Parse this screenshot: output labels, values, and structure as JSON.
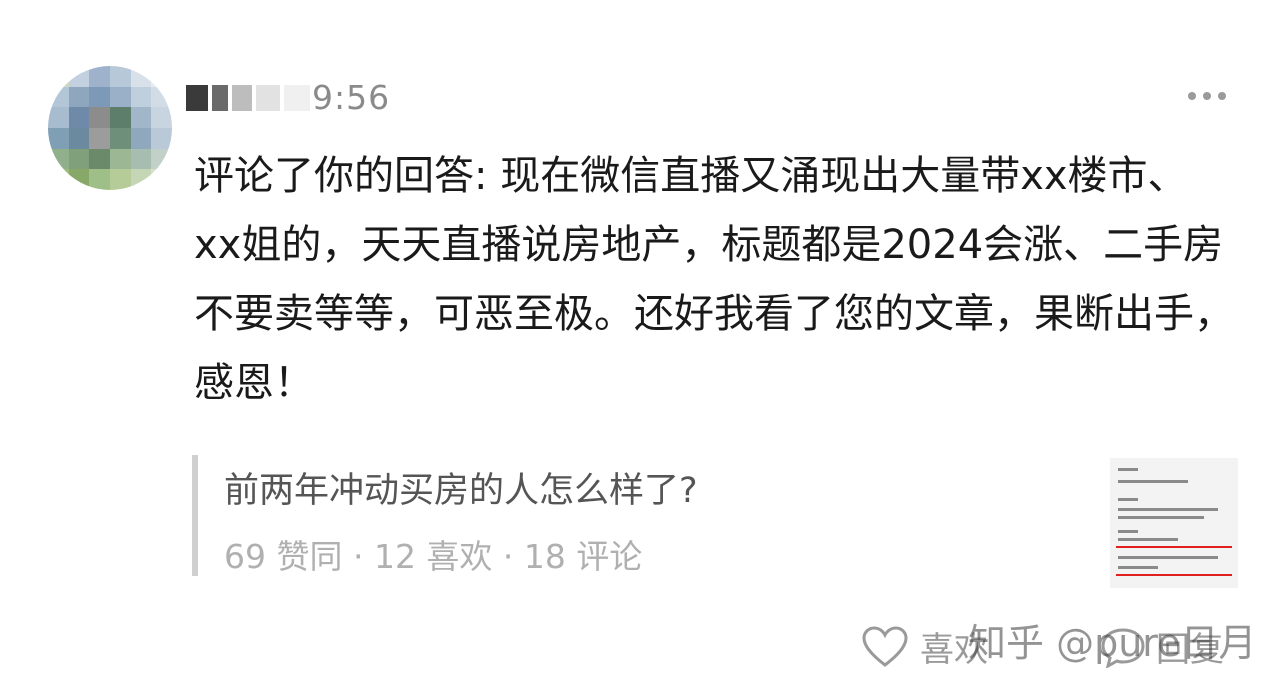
{
  "header": {
    "time": "9:56"
  },
  "comment": {
    "text": "评论了你的回答: 现在微信直播又涌现出大量带xx楼市、xx姐的，天天直播说房地产，标题都是2024会涨、二手房不要卖等等，可恶至极。还好我看了您的文章，果断出手，感恩！"
  },
  "answer": {
    "title": "前两年冲动买房的人怎么样了?",
    "stats": "69 赞同 · 12 喜欢 · 18 评论"
  },
  "footer": {
    "like_label": "喜欢",
    "reply_label": "回复",
    "watermark": "知乎 @pure日月"
  },
  "icons": {
    "more": "more-horizontal-icon",
    "heart": "heart-icon",
    "reply": "reply-bubble-icon"
  }
}
